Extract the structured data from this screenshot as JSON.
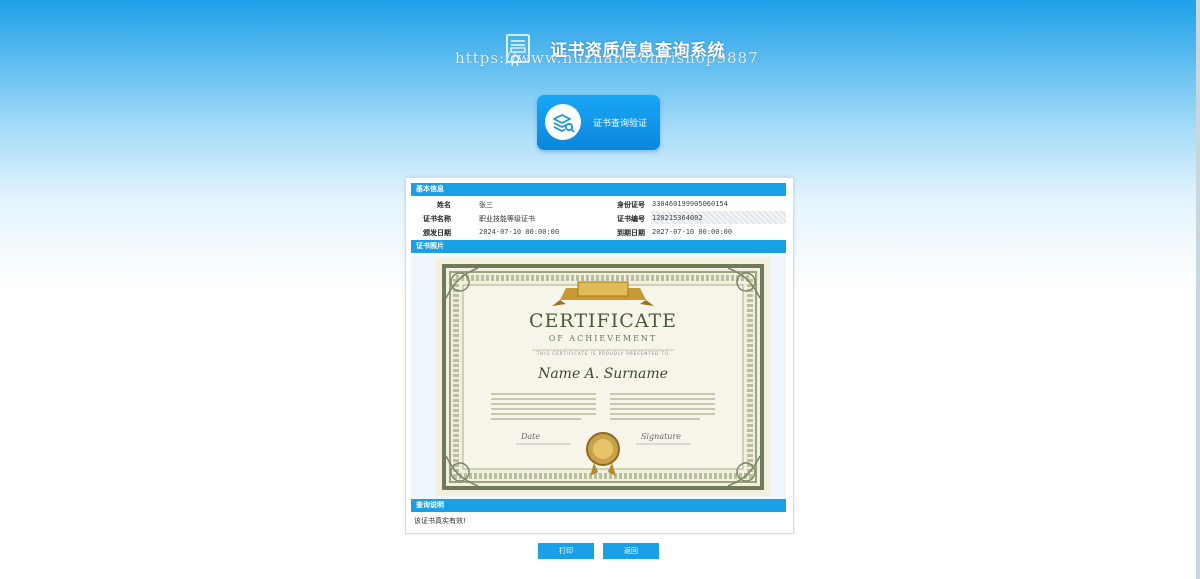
{
  "header": {
    "title": "证书资质信息查询系统",
    "watermark": "https://www.huzhan.com/ishop9887"
  },
  "verify_button": {
    "label": "证书查询验证"
  },
  "basic_info": {
    "section_title": "基本信息",
    "name_label": "姓名",
    "name_value": "张三",
    "id_label": "身份证号",
    "id_value": "330460199905060154",
    "cert_name_label": "证书名称",
    "cert_name_value": "职业技能等级证书",
    "cert_no_label": "证书编号",
    "cert_no_value": "120215364002",
    "issue_label": "颁发日期",
    "issue_value": "2024-07-10 00:00:00",
    "expire_label": "到期日期",
    "expire_value": "2027-07-10 00:00:00"
  },
  "photo_section": {
    "section_title": "证书照片"
  },
  "certificate": {
    "heading": "CERTIFICATE",
    "subheading": "OF ACHIEVEMENT",
    "presented": "THIS CERTIFICATE IS PROUDLY PRESENTED TO",
    "recipient": "Name A. Surname",
    "date_label": "Date",
    "signature_label": "Signature"
  },
  "query_note": {
    "section_title": "查询说明",
    "text": "该证书真实有效!"
  },
  "actions": {
    "print": "打印",
    "back": "返回"
  },
  "colors": {
    "accent": "#1aa0e6",
    "header_top": "#1ea0e8"
  }
}
